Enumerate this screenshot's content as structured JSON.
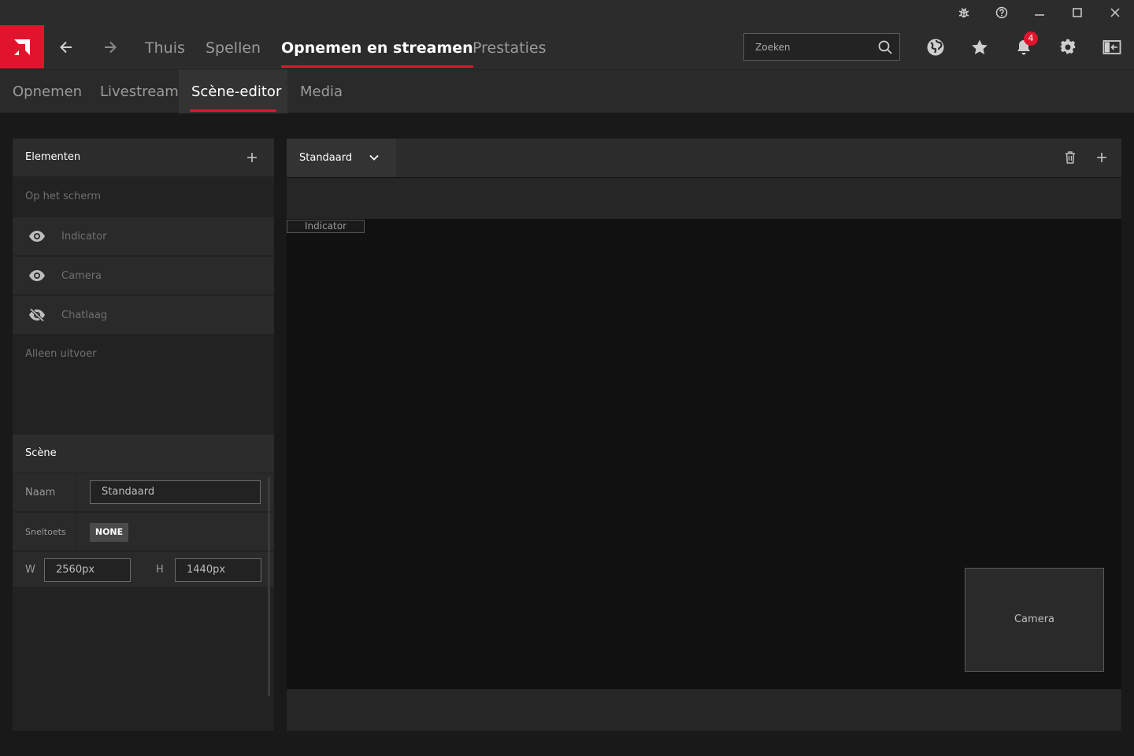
{
  "titlebar": {
    "icons": [
      "bug-icon",
      "help-icon",
      "minimize-icon",
      "maximize-icon",
      "close-icon"
    ]
  },
  "nav": {
    "tabs": [
      {
        "label": "Thuis"
      },
      {
        "label": "Spellen"
      },
      {
        "label": "Opnemen en streamen",
        "active": true
      },
      {
        "label": "Prestaties"
      }
    ],
    "search_placeholder": "Zoeken",
    "notifications_count": "4",
    "icons": [
      "globe-icon",
      "star-icon",
      "bell-icon",
      "gear-icon",
      "sidebar-toggle-icon"
    ]
  },
  "subnav": {
    "tabs": [
      {
        "label": "Opnemen"
      },
      {
        "label": "Livestream"
      },
      {
        "label": "Scène-editor",
        "active": true
      },
      {
        "label": "Media"
      }
    ]
  },
  "elements_panel": {
    "title": "Elementen",
    "on_screen_label": "Op het scherm",
    "items": [
      {
        "label": "Indicator",
        "visible": true
      },
      {
        "label": "Camera",
        "visible": true
      },
      {
        "label": "Chatlaag",
        "visible": false
      }
    ],
    "output_only_label": "Alleen uitvoer"
  },
  "scene_panel": {
    "title": "Scène",
    "name_label": "Naam",
    "name_value": "Standaard",
    "hotkey_label": "Sneltoets",
    "hotkey_value": "NONE",
    "w_label": "W",
    "w_value": "2560px",
    "h_label": "H",
    "h_value": "1440px"
  },
  "editor": {
    "scene_select": "Standaard",
    "indicator_label": "Indicator",
    "camera_label": "Camera"
  },
  "colors": {
    "accent": "#e0152d"
  }
}
